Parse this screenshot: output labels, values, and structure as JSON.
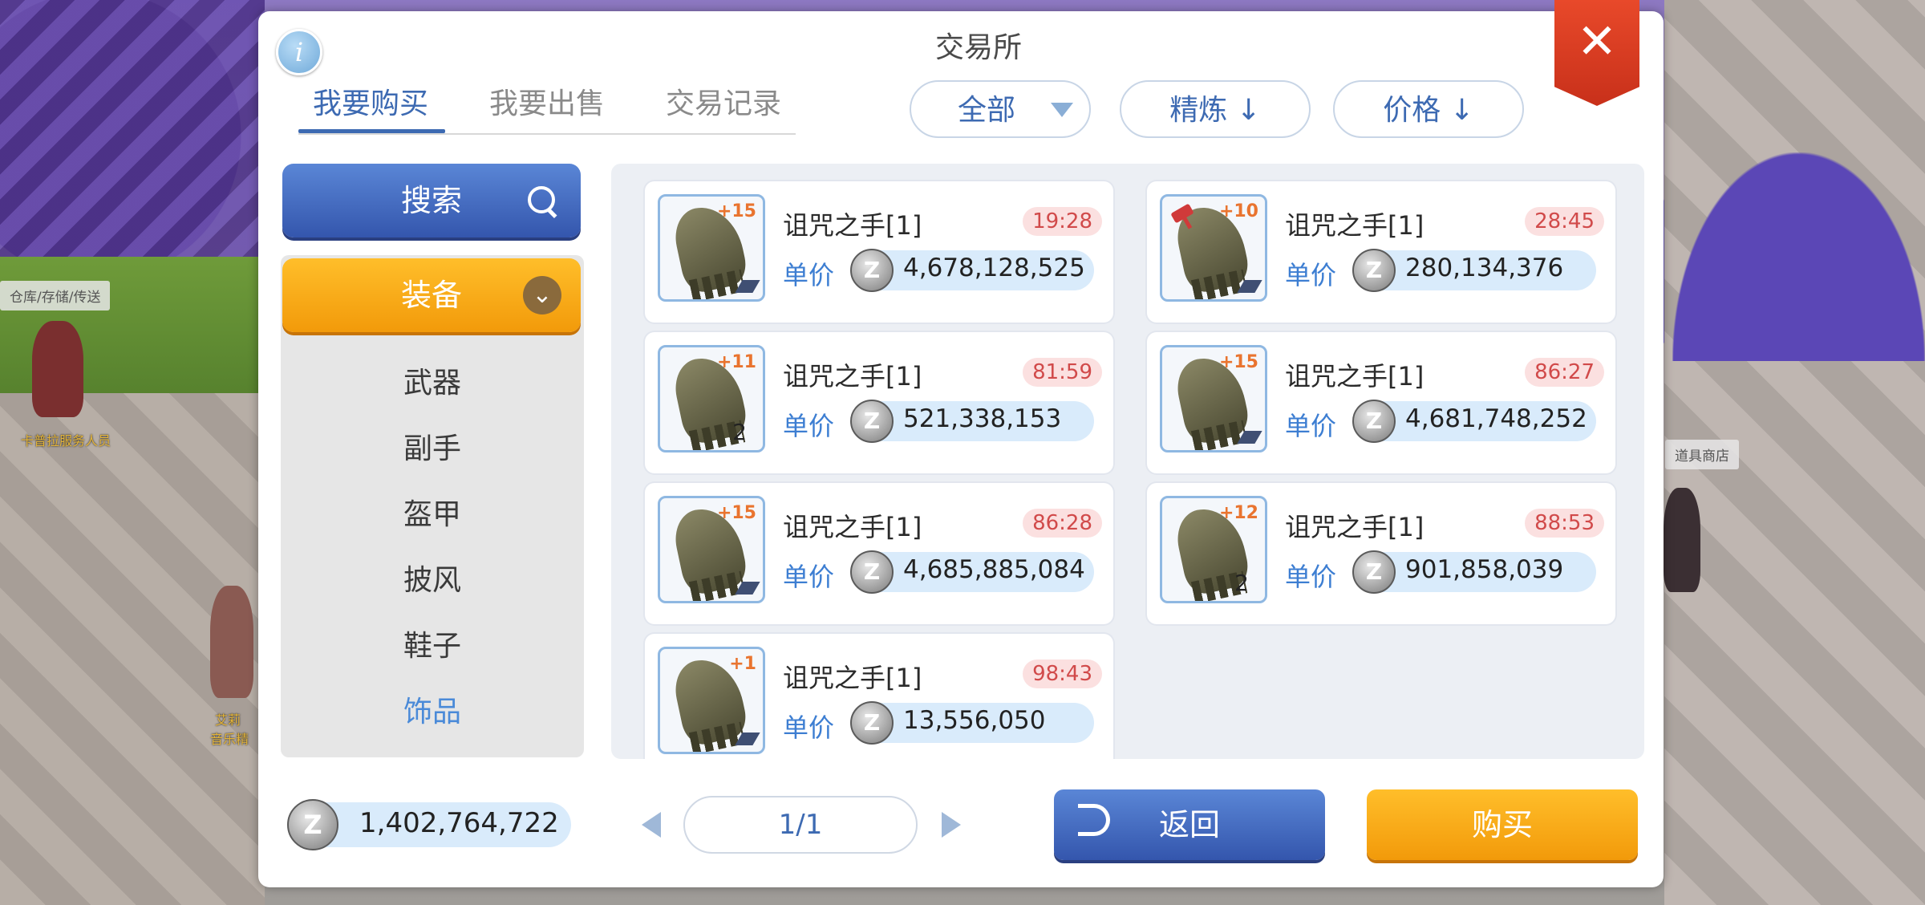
{
  "window": {
    "title": "交易所",
    "info_glyph": "i",
    "close_glyph": "✕"
  },
  "tabs": [
    {
      "label": "我要购买",
      "active": true
    },
    {
      "label": "我要出售",
      "active": false
    },
    {
      "label": "交易记录",
      "active": false
    }
  ],
  "filters": {
    "category": "全部",
    "refine_sort": "精炼 ↓",
    "price_sort": "价格 ↓"
  },
  "sidebar": {
    "search_label": "搜索",
    "equipment_label": "装备",
    "categories": [
      {
        "label": "武器",
        "active": false
      },
      {
        "label": "副手",
        "active": false
      },
      {
        "label": "盔甲",
        "active": false
      },
      {
        "label": "披风",
        "active": false
      },
      {
        "label": "鞋子",
        "active": false
      },
      {
        "label": "饰品",
        "active": true
      }
    ]
  },
  "listings": [
    {
      "name": "诅咒之手[1]",
      "refine": "+15",
      "timer": "19:28",
      "price_label": "单价",
      "price": "4,678,128,525",
      "qty": "",
      "icon": "cursed-hand-icon"
    },
    {
      "name": "诅咒之手[1]",
      "refine": "+10",
      "timer": "28:45",
      "price_label": "单价",
      "price": "280,134,376",
      "qty": "",
      "icon": "cursed-hand-icon"
    },
    {
      "name": "诅咒之手[1]",
      "refine": "+11",
      "timer": "81:59",
      "price_label": "单价",
      "price": "521,338,153",
      "qty": "2",
      "icon": "cursed-hand-icon"
    },
    {
      "name": "诅咒之手[1]",
      "refine": "+15",
      "timer": "86:27",
      "price_label": "单价",
      "price": "4,681,748,252",
      "qty": "",
      "icon": "cursed-hand-icon"
    },
    {
      "name": "诅咒之手[1]",
      "refine": "+15",
      "timer": "86:28",
      "price_label": "单价",
      "price": "4,685,885,084",
      "qty": "",
      "icon": "cursed-hand-icon"
    },
    {
      "name": "诅咒之手[1]",
      "refine": "+12",
      "timer": "88:53",
      "price_label": "单价",
      "price": "901,858,039",
      "qty": "2",
      "icon": "cursed-hand-icon"
    },
    {
      "name": "诅咒之手[1]",
      "refine": "+1",
      "timer": "98:43",
      "price_label": "单价",
      "price": "13,556,050",
      "qty": "",
      "icon": "cursed-hand-icon"
    }
  ],
  "zeny_glyph": "Z",
  "wallet": {
    "amount": "1,402,764,722"
  },
  "pagination": {
    "page": "1/1"
  },
  "actions": {
    "back_label": "返回",
    "buy_label": "购买"
  },
  "scene": {
    "label_storage": "仓库/存储/传送",
    "label_item_shop": "道具商店",
    "npc_name_left": "卡普拉服务人员",
    "npc_name_mid": "艾莉",
    "npc_name_mid2": "音乐精"
  },
  "colors": {
    "accent_blue": "#3d6ab2",
    "accent_orange": "#f29a0a",
    "close_red": "#d5391f",
    "timer_red": "#d14a4a"
  }
}
